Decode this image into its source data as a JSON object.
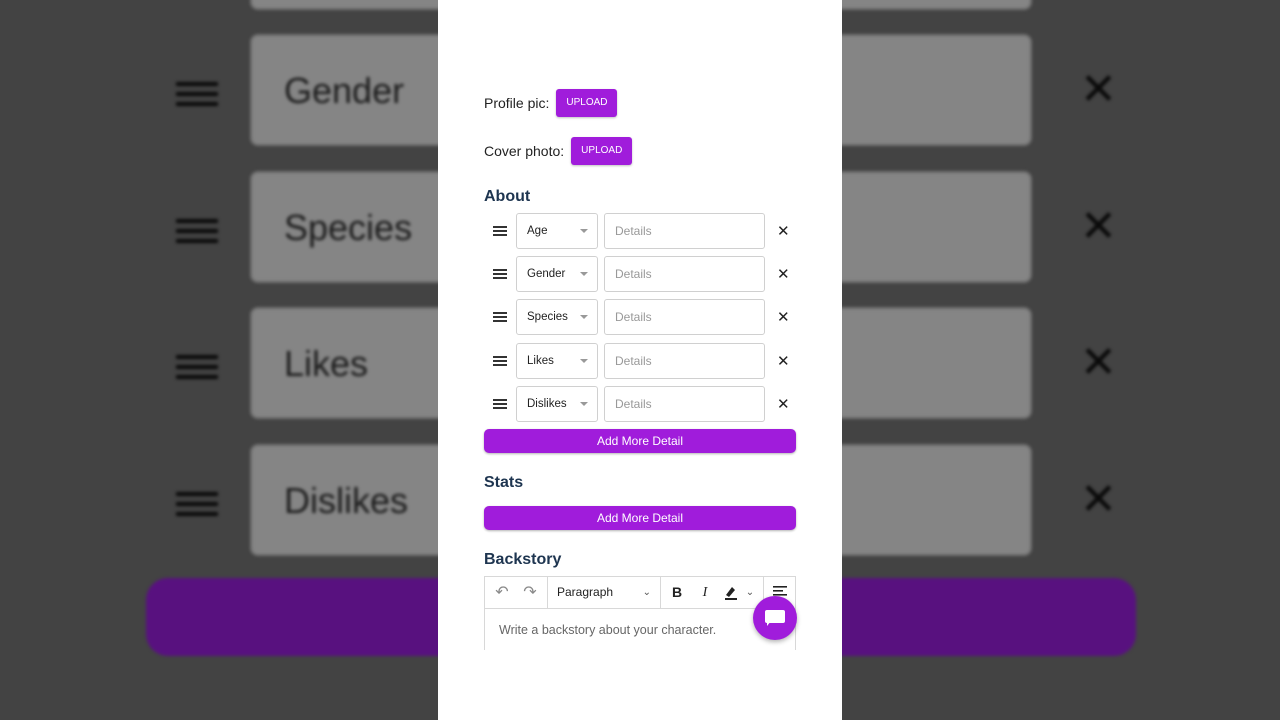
{
  "background": {
    "rows": [
      "Gender",
      "Species",
      "Likes",
      "Dislikes"
    ]
  },
  "profile_pic": {
    "label": "Profile pic:",
    "button": "UPLOAD"
  },
  "cover_photo": {
    "label": "Cover photo:",
    "button": "UPLOAD"
  },
  "about": {
    "title": "About",
    "rows": [
      {
        "type": "Age",
        "details_placeholder": "Details"
      },
      {
        "type": "Gender",
        "details_placeholder": "Details"
      },
      {
        "type": "Species",
        "details_placeholder": "Details"
      },
      {
        "type": "Likes",
        "details_placeholder": "Details"
      },
      {
        "type": "Dislikes",
        "details_placeholder": "Details"
      }
    ],
    "add_button": "Add More Detail"
  },
  "stats": {
    "title": "Stats",
    "add_button": "Add More Detail"
  },
  "backstory": {
    "title": "Backstory",
    "toolbar": {
      "undo": "↶",
      "redo": "↷",
      "block_style": "Paragraph",
      "bold": "B",
      "italic": "I",
      "highlight_icon": "highlight-icon",
      "align_icon": "align-icon"
    },
    "placeholder": "Write a backstory about your character."
  },
  "colors": {
    "accent": "#a01cdb",
    "heading": "#1e3550"
  }
}
